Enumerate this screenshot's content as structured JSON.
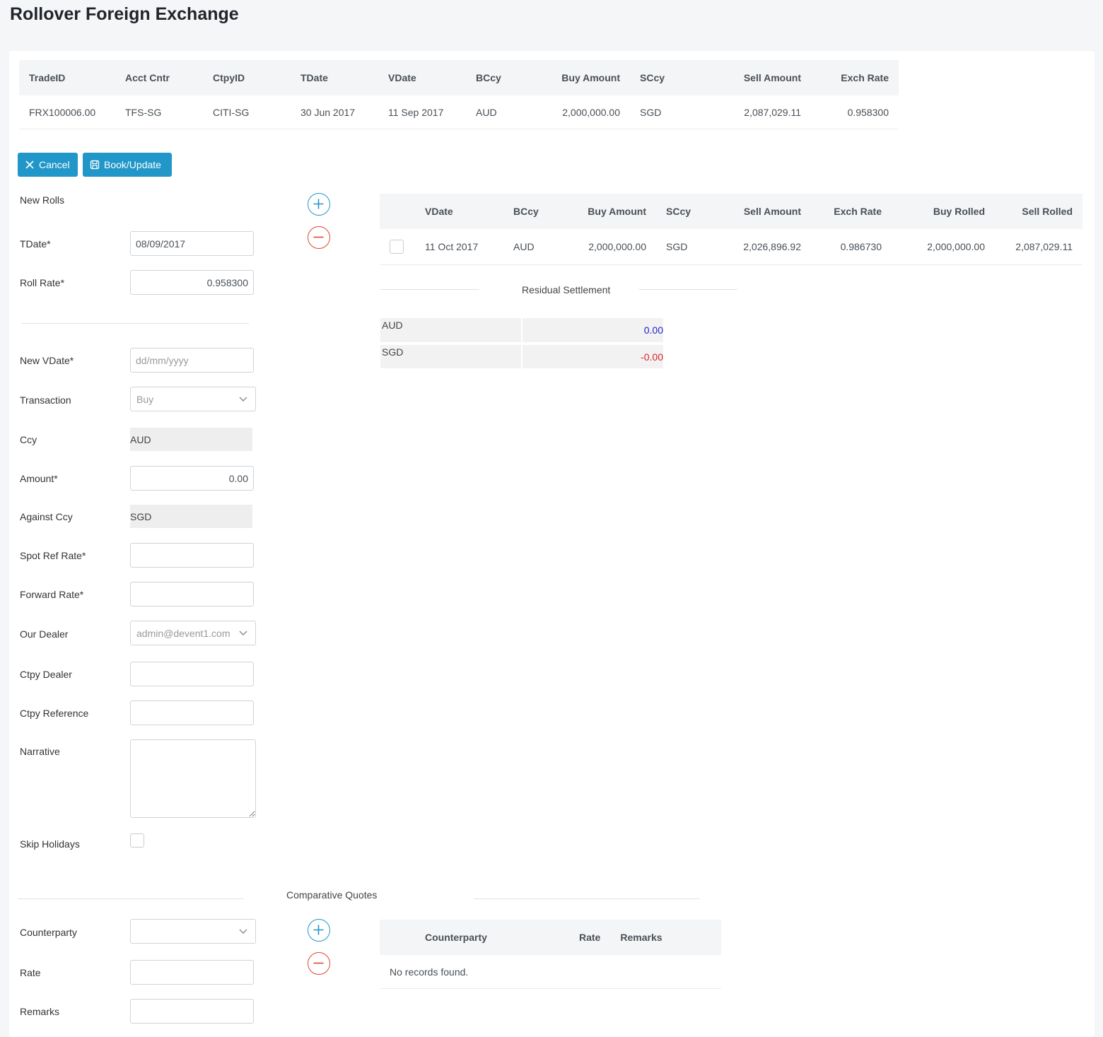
{
  "page": {
    "title": "Rollover Foreign Exchange"
  },
  "trade_table": {
    "headers": [
      "TradeID",
      "Acct Cntr",
      "CtpyID",
      "TDate",
      "VDate",
      "BCcy",
      "Buy Amount",
      "SCcy",
      "Sell Amount",
      "Exch Rate"
    ],
    "row": [
      "FRX100006.00",
      "TFS-SG",
      "CITI-SG",
      "30 Jun 2017",
      "11 Sep 2017",
      "AUD",
      "2,000,000.00",
      "SGD",
      "2,087,029.11",
      "0.958300"
    ]
  },
  "toolbar": {
    "cancel_label": "Cancel",
    "book_label": "Book/Update"
  },
  "form": {
    "section_label": "New Rolls",
    "tdate": {
      "label": "TDate*",
      "value": "08/09/2017"
    },
    "roll_rate": {
      "label": "Roll Rate*",
      "value": "0.958300"
    },
    "new_vdate": {
      "label": "New VDate*",
      "placeholder": "dd/mm/yyyy"
    },
    "transaction": {
      "label": "Transaction",
      "value": "Buy"
    },
    "ccy": {
      "label": "Ccy",
      "value": "AUD"
    },
    "amount": {
      "label": "Amount*",
      "value": "0.00"
    },
    "against_ccy": {
      "label": "Against Ccy",
      "value": "SGD"
    },
    "spot_ref_rate": {
      "label": "Spot Ref Rate*"
    },
    "forward_rate": {
      "label": "Forward Rate*"
    },
    "our_dealer": {
      "label": "Our Dealer",
      "value": "admin@devent1.com"
    },
    "ctpy_dealer": {
      "label": "Ctpy Dealer"
    },
    "ctpy_reference": {
      "label": "Ctpy Reference"
    },
    "narrative": {
      "label": "Narrative"
    },
    "skip_holidays": {
      "label": "Skip Holidays"
    }
  },
  "rolls_table": {
    "headers": [
      "VDate",
      "BCcy",
      "Buy Amount",
      "SCcy",
      "Sell Amount",
      "Exch Rate",
      "Buy Rolled",
      "Sell Rolled"
    ],
    "row": [
      "11 Oct 2017",
      "AUD",
      "2,000,000.00",
      "SGD",
      "2,026,896.92",
      "0.986730",
      "2,000,000.00",
      "2,087,029.11"
    ]
  },
  "residual": {
    "title": "Residual Settlement",
    "rows": [
      {
        "ccy": "AUD",
        "value": "0.00",
        "color": "#2222cc"
      },
      {
        "ccy": "SGD",
        "value": "-0.00",
        "color": "#dd2222"
      }
    ]
  },
  "quotes": {
    "title": "Comparative Quotes",
    "counterparty_label": "Counterparty",
    "rate_label": "Rate",
    "remarks_label": "Remarks",
    "table_headers": [
      "Counterparty",
      "Rate",
      "Remarks"
    ],
    "empty_message": "No records found."
  },
  "icons": {
    "add": "plus-circle-icon",
    "remove": "minus-circle-icon",
    "cancel": "close-icon",
    "save": "save-icon",
    "dropdown": "chevron-down-icon"
  },
  "colors": {
    "primary": "#2196c8",
    "add": "#2196c8",
    "remove": "#e0452e"
  }
}
